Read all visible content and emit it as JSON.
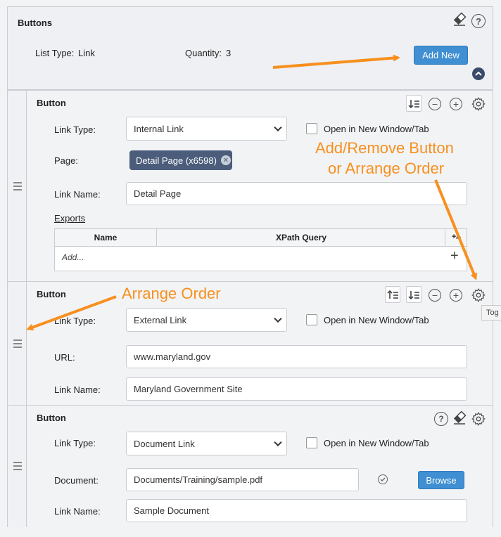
{
  "panel": {
    "title": "Buttons",
    "list_type_label": "List Type:",
    "list_type_value": "Link",
    "quantity_label": "Quantity:",
    "quantity_value": "3",
    "add_new_label": "Add New"
  },
  "items": [
    {
      "title": "Button",
      "link_type_label": "Link Type:",
      "link_type_value": "Internal Link",
      "open_new_label": "Open in New Window/Tab",
      "page_label": "Page:",
      "page_chip": "Detail Page (x6598)",
      "link_name_label": "Link Name:",
      "link_name_value": "Detail Page",
      "exports_label": "Exports",
      "exports_table": {
        "col_name": "Name",
        "col_xpath": "XPath Query",
        "col_addrem": "+/-",
        "add_placeholder": "Add..."
      }
    },
    {
      "title": "Button",
      "link_type_label": "Link Type:",
      "link_type_value": "External Link",
      "open_new_label": "Open in New Window/Tab",
      "url_label": "URL:",
      "url_value": "www.maryland.gov",
      "link_name_label": "Link Name:",
      "link_name_value": "Maryland Government Site"
    },
    {
      "title": "Button",
      "link_type_label": "Link Type:",
      "link_type_value": "Document Link",
      "open_new_label": "Open in New Window/Tab",
      "document_label": "Document:",
      "document_value": "Documents/Training/sample.pdf",
      "browse_label": "Browse",
      "link_name_label": "Link Name:",
      "link_name_value": "Sample Document"
    }
  ],
  "annotations": {
    "add_remove_line1": "Add/Remove Button",
    "add_remove_line2": "or Arrange Order",
    "arrange_order": "Arrange Order"
  },
  "tooltip": "Tog",
  "colors": {
    "accent_blue": "#3f8fd2",
    "chip_bg": "#4b5d7b",
    "annotation_orange": "#f7901e"
  },
  "icons": [
    "eraser-icon",
    "help-icon",
    "collapse-chevron-icon",
    "move-down-icon",
    "move-up-icon",
    "remove-icon",
    "add-icon",
    "settings-icon",
    "drag-handle-icon",
    "verify-icon"
  ]
}
